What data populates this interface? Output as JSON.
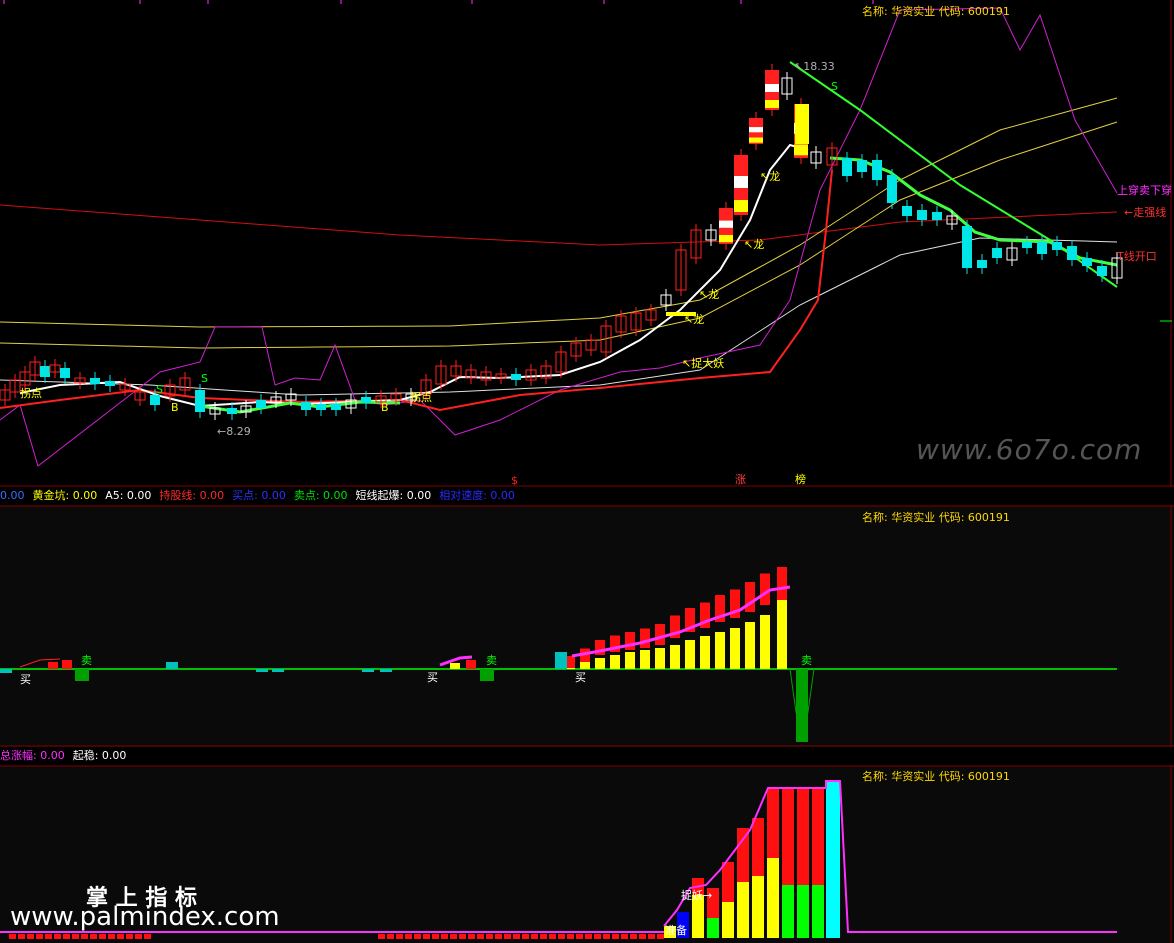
{
  "header": {
    "name_label": "名称: 华资实业 代码: 600191"
  },
  "panel1": {
    "price_high_label": "18.33",
    "price_low_label": "8.29",
    "side_labels": [
      "上穿卖下穿",
      "走强线",
      "T线开口"
    ],
    "annotations": {
      "guaidian": "拐点",
      "long": "龙",
      "zhuodayao": "捉大妖",
      "buy_b": "B",
      "sell_s": "S",
      "zhang": "涨",
      "bang": "榜",
      "s_marker": "$"
    },
    "status_items": [
      {
        "label": "",
        "value": "0.00",
        "color": "#3d6dff"
      },
      {
        "label": "黄金坑: ",
        "value": "0.00",
        "color": "#ffff00"
      },
      {
        "label": "A5: ",
        "value": "0.00",
        "color": "#ffffff"
      },
      {
        "label": "持股线: ",
        "value": "0.00",
        "color": "#ff2a2a"
      },
      {
        "label": "买点: ",
        "value": "0.00",
        "color": "#3030ff"
      },
      {
        "label": "卖点: ",
        "value": "0.00",
        "color": "#00e000"
      },
      {
        "label": "短线起爆: ",
        "value": "0.00",
        "color": "#ffffff"
      },
      {
        "label": "相对速度: ",
        "value": "0.00",
        "color": "#2a2aff"
      }
    ]
  },
  "panel2": {
    "buy_label": "买",
    "sell_label": "卖"
  },
  "panel3": {
    "status_items": [
      {
        "label": "总涨幅: ",
        "value": "0.00",
        "color": "#ff30ff"
      },
      {
        "label": "起稳: ",
        "value": "0.00",
        "color": "#ffffff"
      }
    ],
    "zhuoyao_label": "捉妖→",
    "zhunbei_label": "准备"
  },
  "watermark": {
    "site_top": "www.6o7o.com",
    "cn_brand": "掌 上 指 标",
    "site_bottom": "www.palmindex.com"
  },
  "colors": {
    "bg": "#000000",
    "up": "#ff2020",
    "down": "#00ffff",
    "gold": "#ffff00",
    "magenta": "#ff30ff",
    "green": "#00ff00",
    "white": "#ffffff"
  }
}
